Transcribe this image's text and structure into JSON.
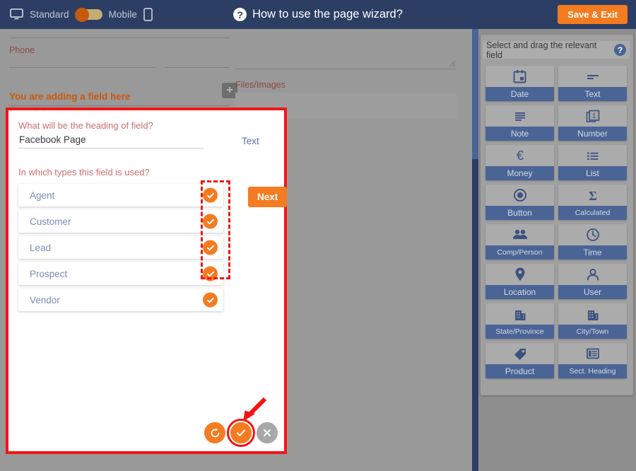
{
  "topbar": {
    "desktop_icon": "monitor-icon",
    "standard_label": "Standard",
    "mobile_label": "Mobile",
    "mobile_icon": "phone-icon",
    "help_icon": "question-mark-icon",
    "help_text": "How to use the page wizard?",
    "save_exit_label": "Save & Exit",
    "bg_color": "#2c3e63",
    "accent_color": "#f47b20"
  },
  "background_form": {
    "phone_label": "Phone",
    "add_button_icon": "plus-icon",
    "adding_field_notice": "You are adding a field here",
    "files_images_label": "Files/Images",
    "resize_grip_icon": "resize-grip-icon"
  },
  "sidebar": {
    "tip_text": "Select and drag the relevant field",
    "tip_icon": "question-mark-icon",
    "field_types": [
      {
        "label": "Date",
        "icon": "calendar-icon"
      },
      {
        "label": "Text",
        "icon": "text-lines-icon"
      },
      {
        "label": "Note",
        "icon": "note-lines-icon"
      },
      {
        "label": "Number",
        "icon": "number-stack-icon"
      },
      {
        "label": "Money",
        "icon": "euro-icon"
      },
      {
        "label": "List",
        "icon": "list-icon"
      },
      {
        "label": "Button",
        "icon": "radio-circle-icon"
      },
      {
        "label": "Calculated",
        "icon": "sigma-icon"
      },
      {
        "label": "Comp/Person",
        "icon": "people-icon"
      },
      {
        "label": "Time",
        "icon": "clock-icon"
      },
      {
        "label": "Location",
        "icon": "map-pin-icon"
      },
      {
        "label": "User",
        "icon": "person-icon"
      },
      {
        "label": "State/Province",
        "icon": "building-icon"
      },
      {
        "label": "City/Town",
        "icon": "building-icon"
      },
      {
        "label": "Product",
        "icon": "tag-icon"
      },
      {
        "label": "Sect. Heading",
        "icon": "section-heading-icon"
      }
    ],
    "scrollbar_icon": "vertical-scrollbar"
  },
  "wizard": {
    "heading_question": "What will be the heading of field?",
    "heading_value": "Facebook Page",
    "heading_placeholder": "",
    "field_type_label": "Text",
    "types_question": "In which types this field is used?",
    "type_options": [
      {
        "label": "Agent",
        "checked": true
      },
      {
        "label": "Customer",
        "checked": true
      },
      {
        "label": "Lead",
        "checked": true
      },
      {
        "label": "Prospect",
        "checked": true
      },
      {
        "label": "Vendor",
        "checked": true
      }
    ],
    "next_label": "Next",
    "actions": {
      "reset_icon": "reset-circular-arrow-icon",
      "confirm_icon": "check-icon",
      "cancel_icon": "close-x-icon"
    },
    "highlight_color": "#f51414"
  }
}
